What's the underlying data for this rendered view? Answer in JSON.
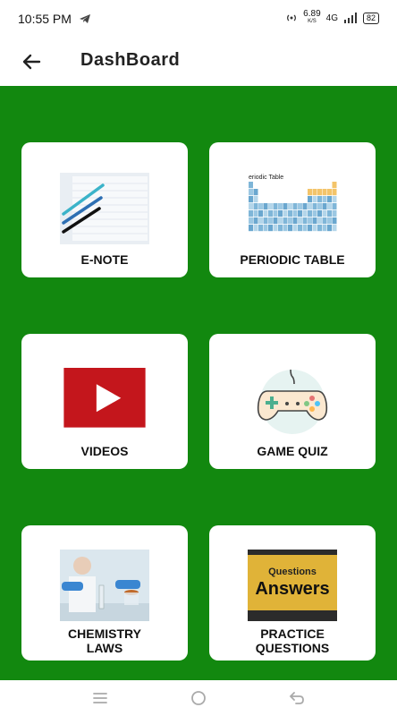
{
  "status_bar": {
    "time": "10:55 PM",
    "speed": "6.89",
    "speed_unit": "K/S",
    "network": "4G",
    "battery": "82"
  },
  "app_bar": {
    "title": "DashBoard"
  },
  "cards": [
    {
      "label": "E-NOTE"
    },
    {
      "label": "PERIODIC TABLE",
      "image_caption": "eriodic Table"
    },
    {
      "label": "VIDEOS"
    },
    {
      "label": "GAME QUIZ"
    },
    {
      "label": "CHEMISTRY\nLAWS"
    },
    {
      "label": "PRACTICE\nQUESTIONS",
      "image_text_1": "Questions",
      "image_text_2": "Answers"
    }
  ],
  "colors": {
    "background": "#12880f",
    "card": "#ffffff",
    "youtube_red": "#c4161c"
  }
}
